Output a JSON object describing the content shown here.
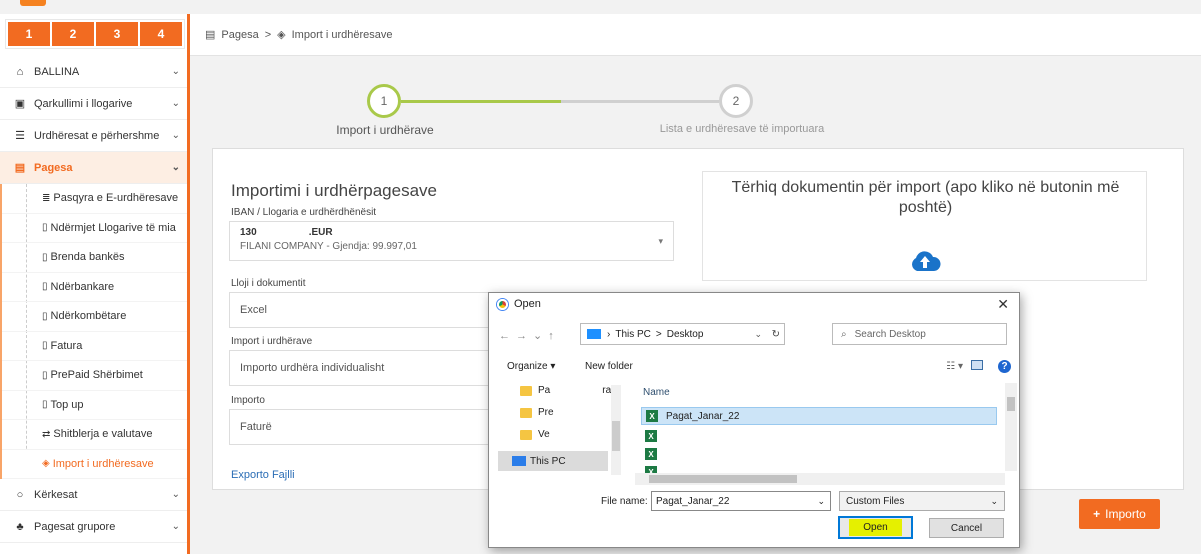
{
  "sidebar": {
    "steps": [
      "1",
      "2",
      "3",
      "4"
    ],
    "menu": [
      {
        "label": "BALLINA"
      },
      {
        "label": "Qarkullimi i llogarive"
      },
      {
        "label": "Urdhëresat e përhershme"
      },
      {
        "label": "Pagesa"
      }
    ],
    "sub": [
      {
        "label": "Pasqyra e E-urdhëresave"
      },
      {
        "label": "Ndërmjet Llogarive të mia"
      },
      {
        "label": "Brenda bankës"
      },
      {
        "label": "Ndërbankare"
      },
      {
        "label": "Ndërkombëtare"
      },
      {
        "label": "Fatura"
      },
      {
        "label": "PrePaid Shërbimet"
      },
      {
        "label": "Top up"
      },
      {
        "label": "Shitblerja e valutave"
      },
      {
        "label": "Import i urdhëresave"
      }
    ],
    "menu2": [
      {
        "label": "Kërkesat"
      },
      {
        "label": "Pagesat grupore"
      }
    ]
  },
  "breadcrumb": {
    "item1": "Pagesa",
    "sep": ">",
    "item2": "Import i urdhëresave"
  },
  "stepper": {
    "step1_num": "1",
    "step1_label": "Import i urdhërave",
    "step2_num": "2",
    "step2_label": "Lista e urdhëresave të importuara"
  },
  "form": {
    "title": "Importimi i urdhërpagesave",
    "iban_label": "IBAN / Llogaria e urdhërdhënësit",
    "iban_line1_a": "130",
    "iban_line1_b": ".EUR",
    "iban_line2": "FILANI COMPANY - Gjendja: 99.997,01",
    "doc_label": "Lloji i dokumentit",
    "doc_value": "Excel",
    "import_label": "Import i urdhërave",
    "import_value": "Importo urdhëra individualisht",
    "importo_label": "Importo",
    "importo_value": "Faturë",
    "export_link": "Exporto Fajlli"
  },
  "dropzone": {
    "text": "Tërhiq dokumentin për import (apo kliko në butonin më poshtë)"
  },
  "importo_button": "Importo",
  "dialog": {
    "title": "Open",
    "close": "✕",
    "address": [
      "This PC",
      ">",
      "Desktop"
    ],
    "search_placeholder": "Search Desktop",
    "organize": "Organize ▾",
    "new_folder": "New folder",
    "help": "?",
    "tree": [
      "Pa",
      "ra",
      "Pre",
      "Ve",
      "This PC"
    ],
    "name_header": "Name",
    "files": [
      "Pagat_Janar_22",
      "",
      "",
      ""
    ],
    "file_name_label": "File name:",
    "file_name_value": "Pagat_Janar_22",
    "file_type": "Custom Files",
    "open_button": "Open",
    "cancel_button": "Cancel"
  }
}
